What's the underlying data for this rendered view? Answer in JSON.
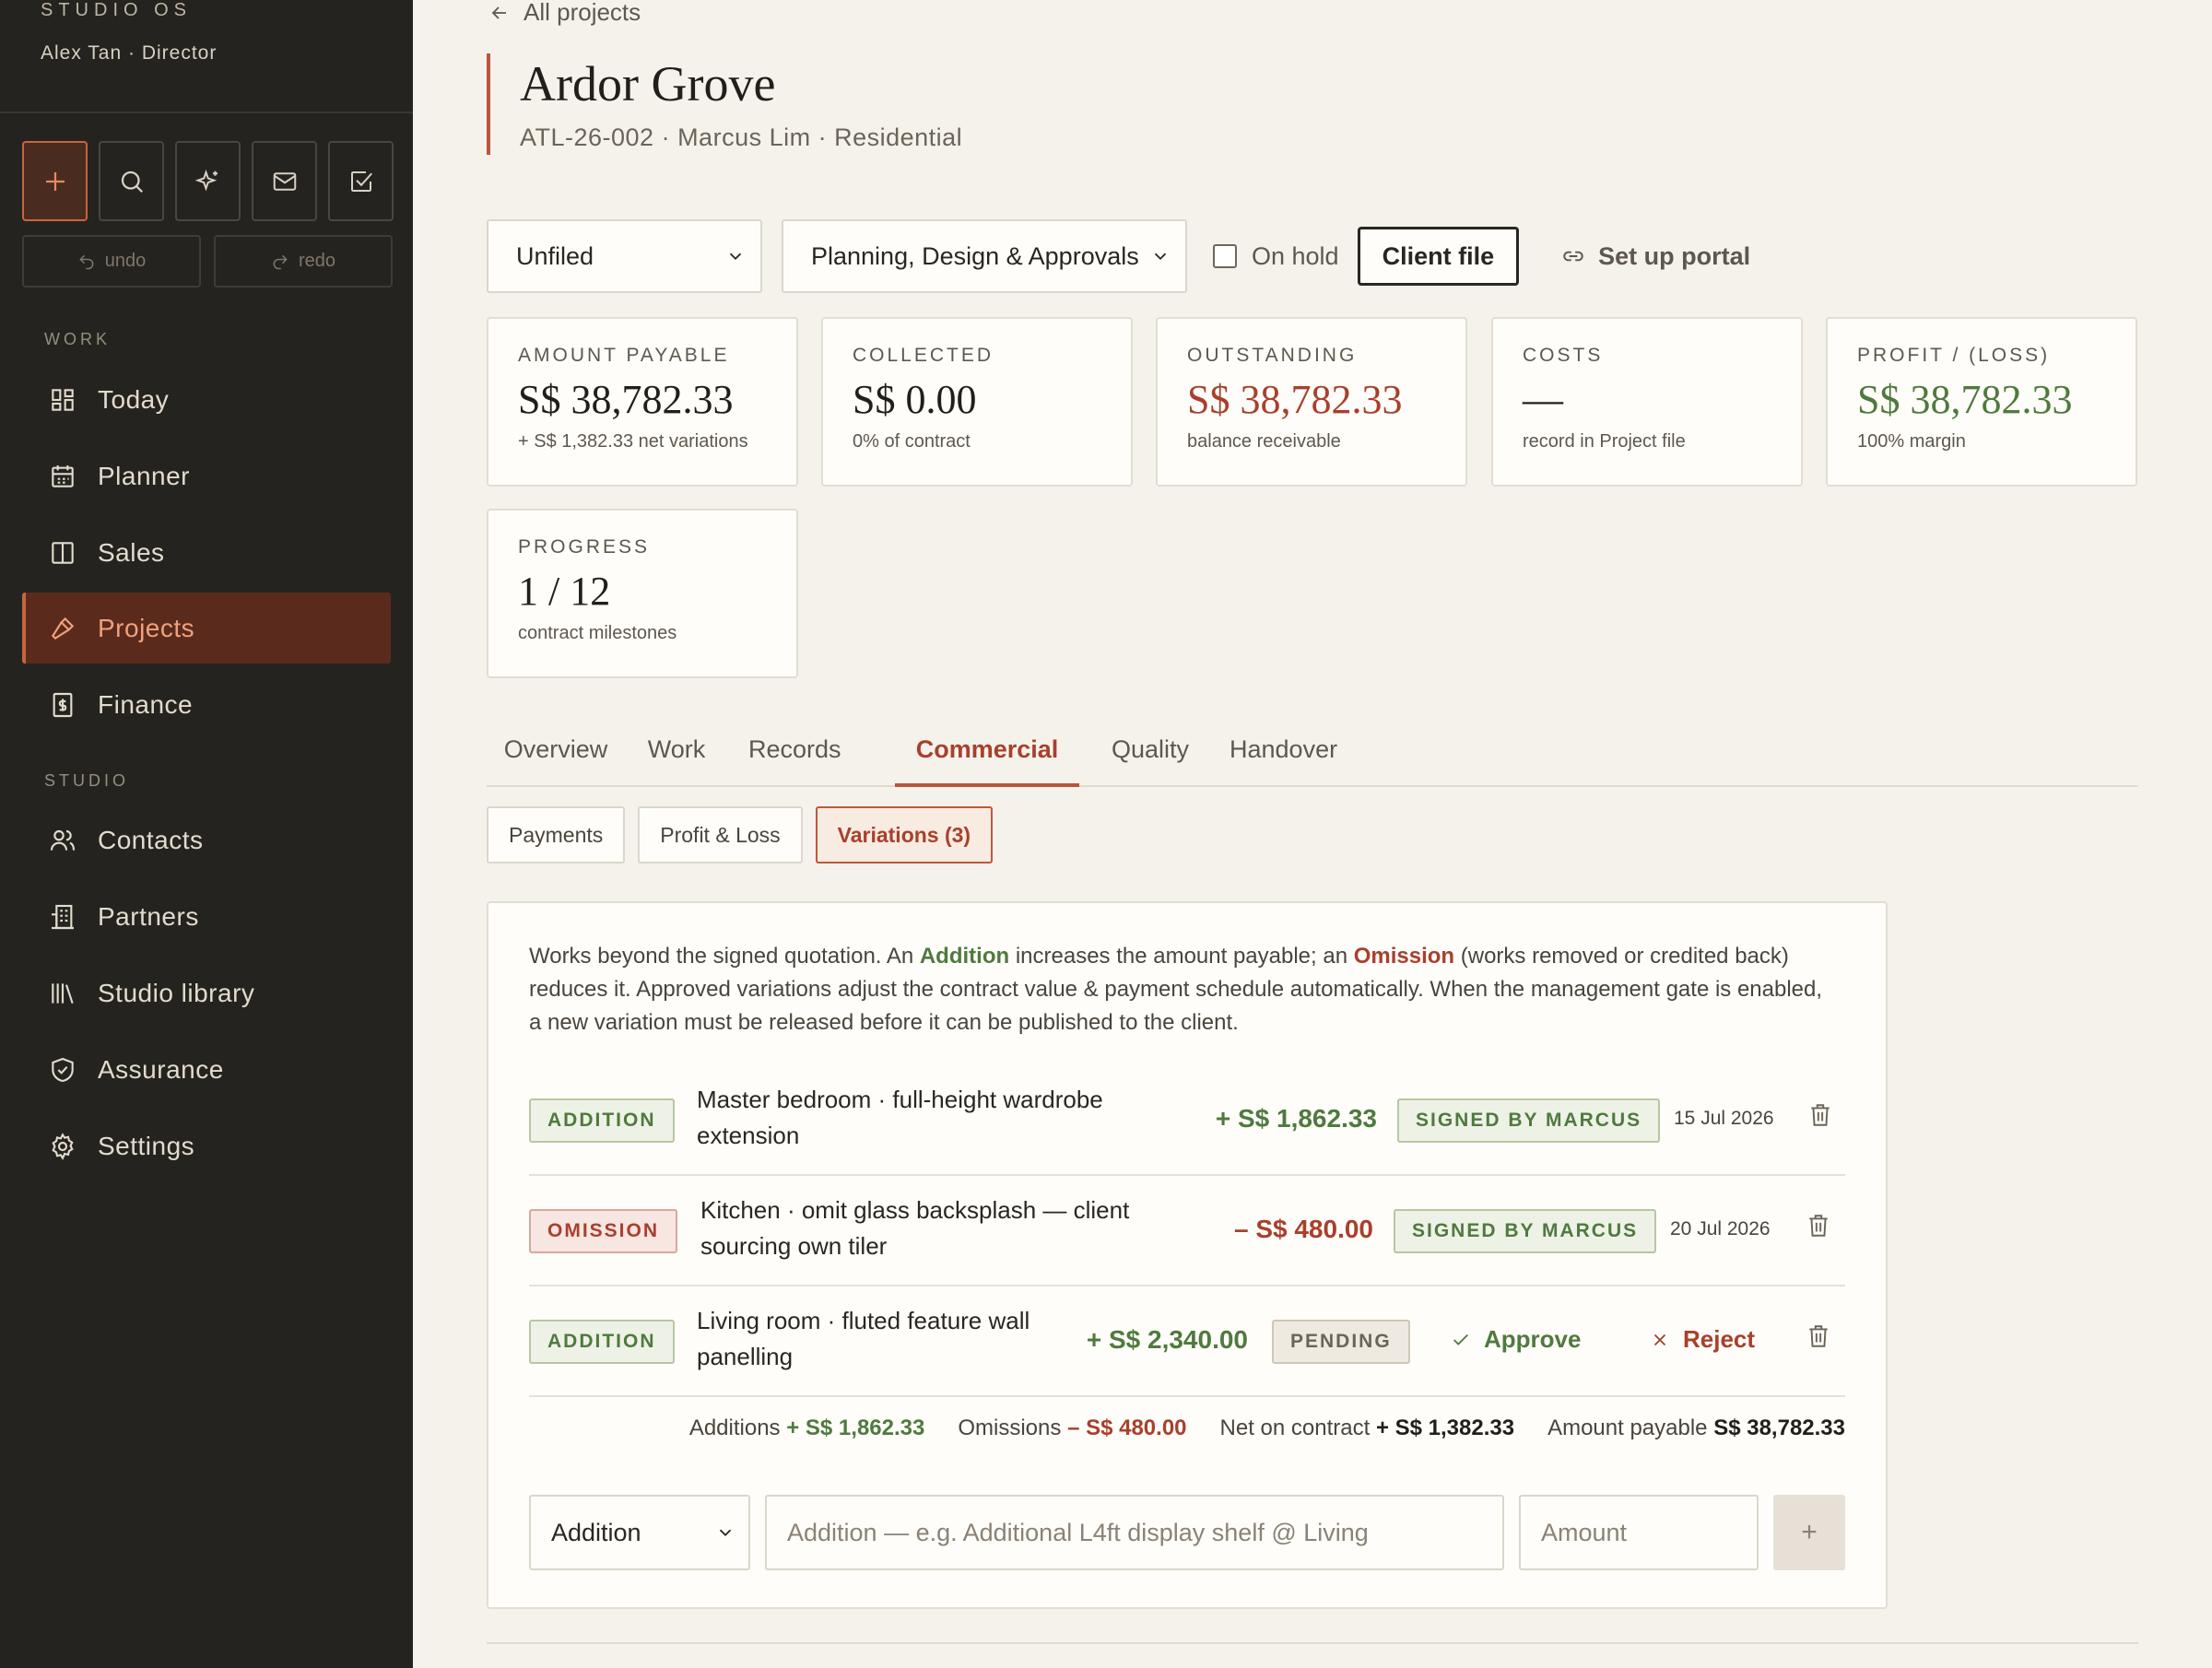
{
  "sidebar": {
    "brand": "STUDIO OS",
    "user": "Alex Tan · Director",
    "undo_label": "undo",
    "redo_label": "redo",
    "work_section": "WORK",
    "studio_section": "STUDIO",
    "work_items": [
      {
        "label": "Today",
        "icon": "dashboard-icon"
      },
      {
        "label": "Planner",
        "icon": "calendar-icon"
      },
      {
        "label": "Sales",
        "icon": "columns-icon"
      },
      {
        "label": "Projects",
        "icon": "hammer-icon",
        "active": true
      },
      {
        "label": "Finance",
        "icon": "invoice-icon"
      }
    ],
    "studio_items": [
      {
        "label": "Contacts",
        "icon": "users-icon"
      },
      {
        "label": "Partners",
        "icon": "building-icon"
      },
      {
        "label": "Studio library",
        "icon": "library-icon"
      },
      {
        "label": "Assurance",
        "icon": "shield-check-icon"
      },
      {
        "label": "Settings",
        "icon": "gear-icon"
      }
    ]
  },
  "header": {
    "back_label": "All projects",
    "title": "Ardor Grove",
    "subtitle": "ATL-26-002 · Marcus Lim · Residential"
  },
  "controls": {
    "filing_value": "Unfiled",
    "stage_value": "Planning, Design & Approvals",
    "on_hold_label": "On hold",
    "client_file_label": "Client file",
    "portal_label": "Set up portal"
  },
  "kpis": [
    {
      "label": "AMOUNT PAYABLE",
      "value": "S$ 38,782.33",
      "sub": "+ S$ 1,382.33 net variations",
      "tone": "default"
    },
    {
      "label": "COLLECTED",
      "value": "S$ 0.00",
      "sub": "0% of contract",
      "tone": "default"
    },
    {
      "label": "OUTSTANDING",
      "value": "S$ 38,782.33",
      "sub": "balance receivable",
      "tone": "red"
    },
    {
      "label": "COSTS",
      "value": "—",
      "sub": "record in Project file",
      "tone": "default"
    },
    {
      "label": "PROFIT / (LOSS)",
      "value": "S$ 38,782.33",
      "sub": "100% margin",
      "tone": "green"
    },
    {
      "label": "PROGRESS",
      "value": "1 / 12",
      "sub": "contract milestones",
      "tone": "default"
    }
  ],
  "tabs": [
    "Overview",
    "Work",
    "Records",
    "Commercial",
    "Quality",
    "Handover"
  ],
  "active_tab": "Commercial",
  "subtabs": [
    "Payments",
    "Profit & Loss",
    "Variations (3)"
  ],
  "active_subtab": "Variations (3)",
  "variations": {
    "intro_before": "Works beyond the signed quotation. An ",
    "intro_addition": "Addition",
    "intro_middle": " increases the amount payable; an ",
    "intro_omission": "Omission",
    "intro_after": " (works removed or credited back) reduces it. Approved variations adjust the contract value & payment schedule automatically. When the management gate is enabled, a new variation must be released before it can be published to the client.",
    "rows": [
      {
        "type": "ADDITION",
        "description": "Master bedroom · full-height wardrobe extension",
        "amount": "+ S$ 1,862.33",
        "status": "SIGNED BY MARCUS",
        "date": "15 Jul 2026"
      },
      {
        "type": "OMISSION",
        "description": "Kitchen · omit glass backsplash — client sourcing own tiler",
        "amount": "– S$ 480.00",
        "status": "SIGNED BY MARCUS",
        "date": "20 Jul 2026"
      },
      {
        "type": "ADDITION",
        "description": "Living room · fluted feature wall panelling",
        "amount": "+ S$ 2,340.00",
        "status": "PENDING",
        "approve_label": "Approve",
        "reject_label": "Reject"
      }
    ],
    "totals": {
      "additions_label": "Additions",
      "additions_value": "+ S$ 1,862.33",
      "omissions_label": "Omissions",
      "omissions_value": "– S$ 480.00",
      "net_label": "Net on contract",
      "net_value": "+ S$ 1,382.33",
      "payable_label": "Amount payable",
      "payable_value": "S$ 38,782.33"
    },
    "new_row": {
      "type_value": "Addition",
      "description_placeholder": "Addition — e.g. Additional L4ft display shelf @ Living",
      "amount_placeholder": "Amount",
      "add_label": "+"
    }
  },
  "colors": {
    "accent": "#b9553a",
    "sidebar_bg": "#25231f",
    "page_bg": "#f5f2ec",
    "green": "#4f7a3e",
    "red": "#a8402c"
  }
}
